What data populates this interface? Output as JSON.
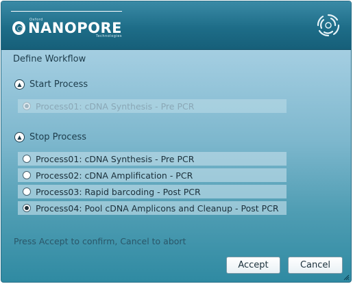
{
  "header": {
    "logo_main": "NANOPORE",
    "logo_top": "Oxford",
    "logo_bottom": "Technologies",
    "brand_icon": "swirl-logo-icon"
  },
  "title": "Define Workflow",
  "start": {
    "label": "Start Process",
    "options": [
      {
        "label": "Process01: cDNA Synthesis - Pre PCR",
        "checked": true,
        "disabled": true
      }
    ]
  },
  "stop": {
    "label": "Stop Process",
    "options": [
      {
        "label": "Process01: cDNA Synthesis - Pre PCR",
        "checked": false
      },
      {
        "label": "Process02: cDNA Amplification - PCR",
        "checked": false
      },
      {
        "label": "Process03: Rapid barcoding - Post PCR",
        "checked": false
      },
      {
        "label": "Process04:  Pool cDNA Amplicons and Cleanup - Post PCR",
        "checked": true
      }
    ]
  },
  "hint": "Press Accept to confirm, Cancel to abort",
  "buttons": {
    "accept": "Accept",
    "cancel": "Cancel"
  },
  "colors": {
    "header": "#1e6d88",
    "accent": "#2f8aa2"
  }
}
